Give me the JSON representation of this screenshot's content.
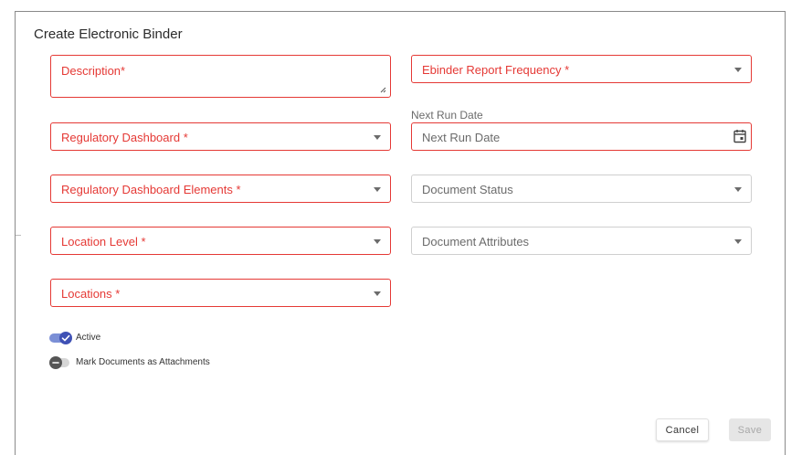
{
  "dialog": {
    "title": "Create Electronic Binder"
  },
  "left_fields": {
    "description": "Description*",
    "regulatory_dashboard": "Regulatory Dashboard *",
    "regulatory_dashboard_elements": "Regulatory Dashboard Elements *",
    "location_level": "Location Level *",
    "locations": "Locations *"
  },
  "right_fields": {
    "ebinder_report_frequency": "Ebinder Report Frequency *",
    "next_run_date_label": "Next Run Date",
    "next_run_date_placeholder": "Next Run Date",
    "document_status": "Document Status",
    "document_attributes": "Document Attributes"
  },
  "toggles": {
    "active": {
      "label": "Active",
      "on": true
    },
    "mark_attachments": {
      "label": "Mark Documents as Attachments",
      "on": false
    }
  },
  "buttons": {
    "cancel": "Cancel",
    "save": "Save"
  },
  "colors": {
    "required_border": "#e53935",
    "toggle_on": "#3f51b5",
    "toggle_on_track": "#7b8fd6",
    "toggle_off_knob": "#555555",
    "toggle_off_track": "#d6d6d6"
  },
  "icons": {
    "dropdown": "caret-down-icon",
    "calendar": "calendar-icon",
    "resize": "resize-handle-icon",
    "check": "check-icon",
    "minus": "minus-icon"
  }
}
